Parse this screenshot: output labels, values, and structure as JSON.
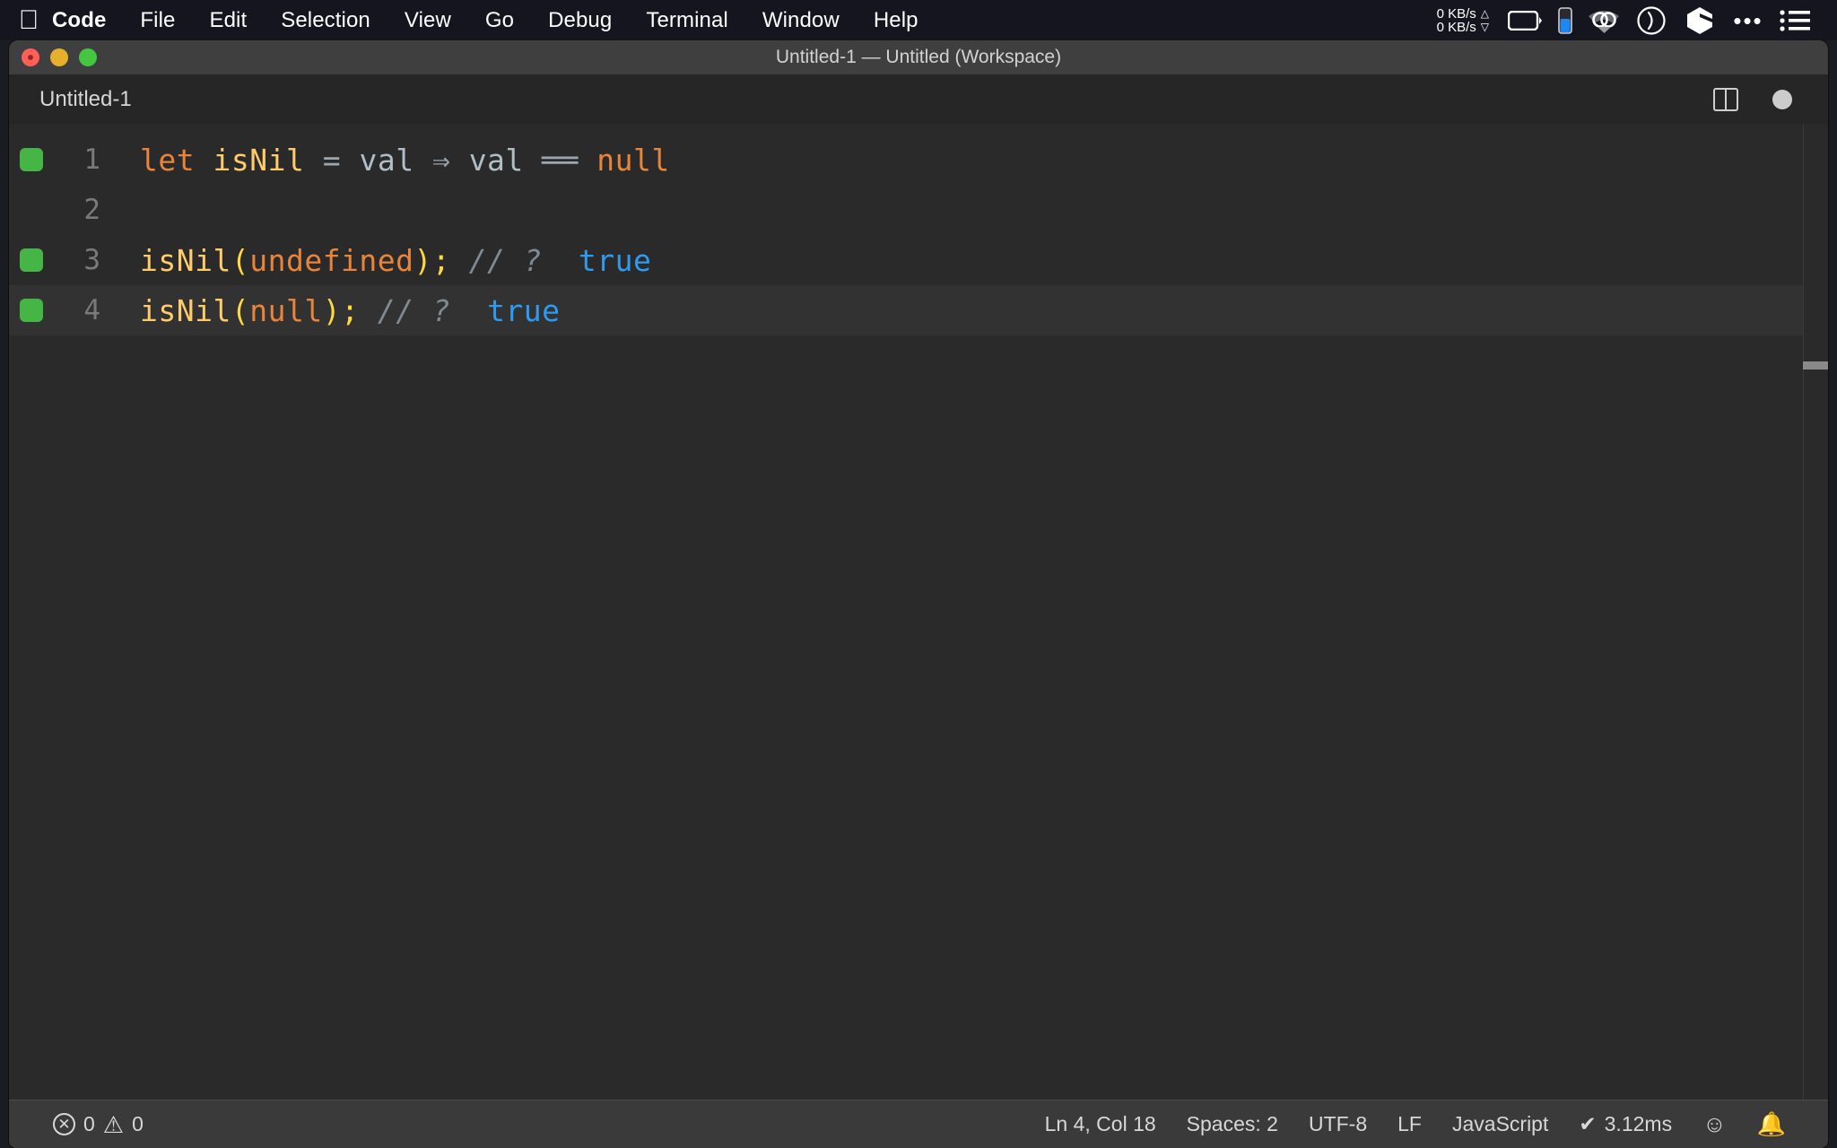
{
  "menubar": {
    "apple_icon": "apple-logo",
    "items": [
      {
        "label": "Code",
        "bold": true
      },
      {
        "label": "File",
        "bold": false
      },
      {
        "label": "Edit",
        "bold": false
      },
      {
        "label": "Selection",
        "bold": false
      },
      {
        "label": "View",
        "bold": false
      },
      {
        "label": "Go",
        "bold": false
      },
      {
        "label": "Debug",
        "bold": false
      },
      {
        "label": "Terminal",
        "bold": false
      },
      {
        "label": "Window",
        "bold": false
      },
      {
        "label": "Help",
        "bold": false
      }
    ],
    "tray": {
      "net_up": "0 KB/s",
      "net_up_arrow": "△",
      "net_down": "0 KB/s",
      "net_down_arrow": "▽",
      "icons": [
        "battery-icon",
        "blue-indicator-icon",
        "wifi-icon",
        "clock-icon",
        "cube-icon",
        "ellipsis-icon",
        "list-icon"
      ]
    }
  },
  "window": {
    "title": "Untitled-1 — Untitled (Workspace)",
    "traffic_lights": [
      "close-button",
      "minimize-button",
      "maximize-button"
    ]
  },
  "tabs": {
    "active": "Untitled-1",
    "actions": [
      "split-editor-icon",
      "unsaved-dot-icon"
    ]
  },
  "editor": {
    "lines": [
      {
        "number": "1",
        "marker": true,
        "current": false,
        "tokens": [
          {
            "text": "let",
            "cls": "t-kw"
          },
          {
            "text": " ",
            "cls": "t-op"
          },
          {
            "text": "isNil",
            "cls": "t-fn"
          },
          {
            "text": " ",
            "cls": "t-op"
          },
          {
            "text": "=",
            "cls": "t-op"
          },
          {
            "text": " ",
            "cls": "t-op"
          },
          {
            "text": "val",
            "cls": "t-var"
          },
          {
            "text": " ",
            "cls": "t-op"
          },
          {
            "text": "⇒",
            "cls": "t-op"
          },
          {
            "text": " ",
            "cls": "t-op"
          },
          {
            "text": "val",
            "cls": "t-var"
          },
          {
            "text": " ",
            "cls": "t-op"
          },
          {
            "text": "══",
            "cls": "t-op"
          },
          {
            "text": " ",
            "cls": "t-op"
          },
          {
            "text": "null",
            "cls": "t-const"
          }
        ],
        "plain": "let isNil = val => val == null"
      },
      {
        "number": "2",
        "marker": false,
        "current": false,
        "tokens": [],
        "plain": ""
      },
      {
        "number": "3",
        "marker": true,
        "current": false,
        "tokens": [
          {
            "text": "isNil",
            "cls": "t-fn"
          },
          {
            "text": "(",
            "cls": "t-punct"
          },
          {
            "text": "undefined",
            "cls": "t-const"
          },
          {
            "text": ")",
            "cls": "t-punct"
          },
          {
            "text": ";",
            "cls": "t-punct"
          },
          {
            "text": " ",
            "cls": "t-op"
          },
          {
            "text": "// ?",
            "cls": "t-comment"
          },
          {
            "text": "  ",
            "cls": "t-op"
          },
          {
            "text": "true",
            "cls": "t-bool"
          }
        ],
        "plain": "isNil(undefined); // ?  true"
      },
      {
        "number": "4",
        "marker": true,
        "current": true,
        "tokens": [
          {
            "text": "isNil",
            "cls": "t-fn"
          },
          {
            "text": "(",
            "cls": "t-punct"
          },
          {
            "text": "null",
            "cls": "t-const"
          },
          {
            "text": ")",
            "cls": "t-punct"
          },
          {
            "text": ";",
            "cls": "t-punct"
          },
          {
            "text": " ",
            "cls": "t-op"
          },
          {
            "text": "// ?",
            "cls": "t-comment"
          },
          {
            "text": "  ",
            "cls": "t-op"
          },
          {
            "text": "true",
            "cls": "t-bool"
          }
        ],
        "plain": "isNil(null); // ?  true"
      }
    ],
    "language": "JavaScript"
  },
  "statusbar": {
    "errors": "0",
    "warnings": "0",
    "cursor": "Ln 4, Col 18",
    "indentation": "Spaces: 2",
    "encoding": "UTF-8",
    "eol": "LF",
    "language": "JavaScript",
    "quokka_check": "✔",
    "quokka_time": "3.12ms",
    "feedback_icon": "smiley-icon",
    "notifications_icon": "bell-icon"
  },
  "colors": {
    "menubar_bg": "#15151f",
    "titlebar_bg": "#3f3f3f",
    "tabbar_bg": "#262626",
    "editor_bg": "#2a2a2a",
    "current_line_bg": "#323232",
    "statusbar_bg": "#3a3a3a",
    "git_added": "#45b545",
    "keyword": "#e8853a",
    "function": "#ffcb6b",
    "boolean": "#2e9bf0",
    "comment": "#7f8b93",
    "punct": "#ffd740",
    "variable": "#b0bec5"
  }
}
